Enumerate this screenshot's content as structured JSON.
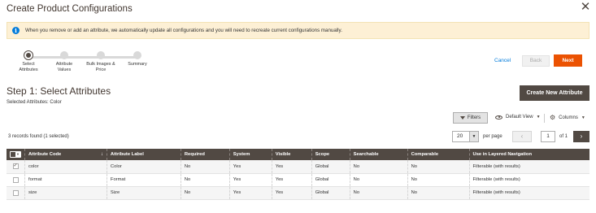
{
  "modal": {
    "title": "Create Product Configurations"
  },
  "notice": {
    "text": "When you remove or add an attribute, we automatically update all configurations and you will need to recreate current configurations manually."
  },
  "steps": [
    {
      "label": "Select Attributes",
      "active": true
    },
    {
      "label": "Attribute Values",
      "active": false
    },
    {
      "label": "Bulk Images & Price",
      "active": false
    },
    {
      "label": "Summary",
      "active": false
    }
  ],
  "nav": {
    "cancel": "Cancel",
    "back": "Back",
    "next": "Next"
  },
  "step_heading": {
    "title": "Step 1: Select Attributes",
    "selected": "Selected Attributes: Color",
    "create_button": "Create New Attribute"
  },
  "toolbar": {
    "filters": "Filters",
    "view": "Default View",
    "columns": "Columns",
    "records": "3 records found (1 selected)",
    "per_page_value": "20",
    "per_page_label": "per page",
    "page_value": "1",
    "page_of": "of 1"
  },
  "table": {
    "columns": [
      "Attribute Code",
      "Attribute Label",
      "Required",
      "System",
      "Visible",
      "Scope",
      "Searchable",
      "Comparable",
      "Use in Layered Navigation"
    ],
    "rows": [
      {
        "checked": true,
        "cells": [
          "color",
          "Color",
          "No",
          "Yes",
          "Yes",
          "Global",
          "No",
          "No",
          "Filterable (with results)"
        ]
      },
      {
        "checked": false,
        "cells": [
          "format",
          "Format",
          "No",
          "Yes",
          "Yes",
          "Global",
          "No",
          "No",
          "Filterable (with results)"
        ]
      },
      {
        "checked": false,
        "cells": [
          "size",
          "Size",
          "No",
          "Yes",
          "Yes",
          "Global",
          "No",
          "No",
          "Filterable (with results)"
        ]
      }
    ]
  },
  "colors": {
    "accent": "#eb5202",
    "header_dark": "#514943",
    "link": "#007bdb",
    "notice_bg": "#fdf0d5"
  }
}
